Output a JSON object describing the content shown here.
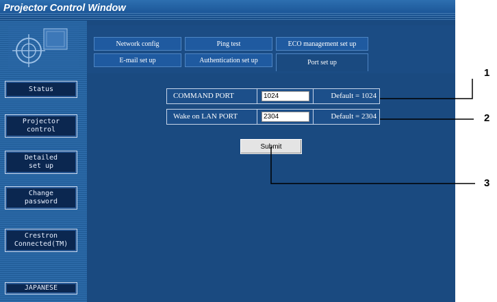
{
  "window": {
    "title": "Projector Control Window"
  },
  "sidebar": {
    "items": [
      {
        "label": "Status"
      },
      {
        "label": "Projector\ncontrol"
      },
      {
        "label": "Detailed\nset up"
      },
      {
        "label": "Change\npassword"
      },
      {
        "label": "Crestron\nConnected(TM)"
      }
    ],
    "language_button": "JAPANESE"
  },
  "tabs": {
    "row1": [
      "Network config",
      "Ping test",
      "ECO management set up"
    ],
    "row2": [
      "E-mail set up",
      "Authentication set up",
      "Port set up"
    ],
    "active": "Port set up"
  },
  "form": {
    "command_port": {
      "label": "COMMAND PORT",
      "value": "1024",
      "default": "Default = 1024"
    },
    "wol_port": {
      "label": "Wake on LAN PORT",
      "value": "2304",
      "default": "Default = 2304"
    },
    "submit_label": "Submit"
  },
  "callouts": [
    "1",
    "2",
    "3"
  ]
}
